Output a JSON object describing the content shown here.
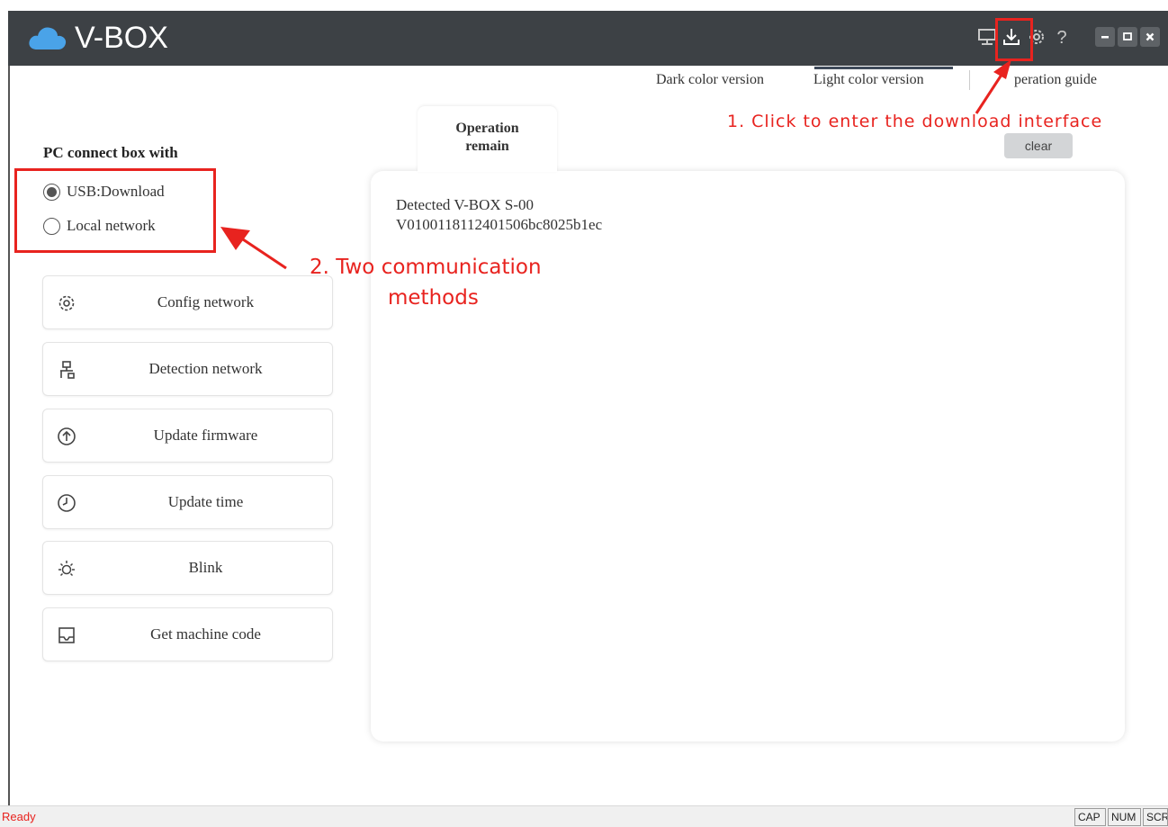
{
  "app": {
    "title": "V-BOX",
    "toolbar_icons": [
      "monitor-icon",
      "download-icon",
      "settings-icon",
      "help-icon"
    ],
    "help_glyph": "?",
    "window_controls": [
      "minimize",
      "maximize",
      "close"
    ]
  },
  "version_tabs": {
    "dark": "Dark color version",
    "light": "Light color version",
    "guide": "peration guide",
    "active": "light"
  },
  "left_panel": {
    "connect_title": "PC connect box with",
    "options": [
      {
        "label": "USB:Download",
        "selected": true
      },
      {
        "label": "Local network",
        "selected": false
      }
    ],
    "buttons": [
      {
        "label": "Config network",
        "icon": "gear-icon"
      },
      {
        "label": "Detection network",
        "icon": "network-icon"
      },
      {
        "label": "Update firmware",
        "icon": "upload-icon"
      },
      {
        "label": "Update time",
        "icon": "clock-icon"
      },
      {
        "label": "Blink",
        "icon": "sun-icon"
      },
      {
        "label": "Get machine code",
        "icon": "tray-icon"
      }
    ]
  },
  "log": {
    "tab_line1": "Operation",
    "tab_line2": "remain",
    "clear_label": "clear",
    "lines": [
      "Detected V-BOX S-00",
      "V0100118112401506bc8025b1ec"
    ]
  },
  "annotations": {
    "step1": "1. Click to enter the download interface",
    "step2_line1": "2. Two communication",
    "step2_line2": "methods",
    "color": "#e8231f"
  },
  "statusbar": {
    "status": "Ready",
    "indicators": [
      "CAP",
      "NUM",
      "SCRL"
    ]
  }
}
